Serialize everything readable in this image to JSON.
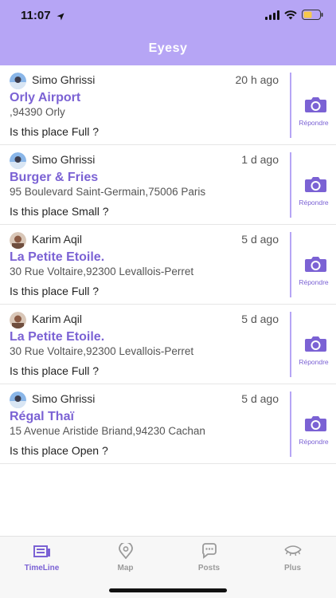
{
  "status_bar": {
    "time": "11:07"
  },
  "header": {
    "title": "Eyesy"
  },
  "feed": [
    {
      "author": "Simo Ghrissi",
      "time_ago": "20 h ago",
      "place": "Orly Airport",
      "address": ",94390 Orly",
      "question": "Is this place Full ?",
      "reply_label": "Répondre"
    },
    {
      "author": "Simo Ghrissi",
      "time_ago": "1 d ago",
      "place": "Burger & Fries",
      "address": "95 Boulevard Saint-Germain,75006 Paris",
      "question": "Is this place Small ?",
      "reply_label": "Répondre"
    },
    {
      "author": "Karim Aqil",
      "time_ago": "5 d ago",
      "place": "La Petite Etoile.",
      "address": "30 Rue Voltaire,92300 Levallois-Perret",
      "question": "Is this place Full ?",
      "reply_label": "Répondre"
    },
    {
      "author": "Karim Aqil",
      "time_ago": "5 d ago",
      "place": "La Petite Etoile.",
      "address": "30 Rue Voltaire,92300 Levallois-Perret",
      "question": "Is this place Full ?",
      "reply_label": "Répondre"
    },
    {
      "author": "Simo Ghrissi",
      "time_ago": "5 d ago",
      "place": "Régal Thaï",
      "address": "15 Avenue Aristide Briand,94230 Cachan",
      "question": "Is this place Open ?",
      "reply_label": "Répondre"
    }
  ],
  "tabs": [
    {
      "label": "TimeLine",
      "icon": "timeline-icon",
      "active": true
    },
    {
      "label": "Map",
      "icon": "map-pin-icon",
      "active": false
    },
    {
      "label": "Posts",
      "icon": "chat-bubble-icon",
      "active": false
    },
    {
      "label": "Plus",
      "icon": "eye-lashes-icon",
      "active": false
    }
  ],
  "colors": {
    "accent": "#7b62d4",
    "header_bg": "#b6a5f5",
    "tab_inactive": "#9a9a9a"
  }
}
